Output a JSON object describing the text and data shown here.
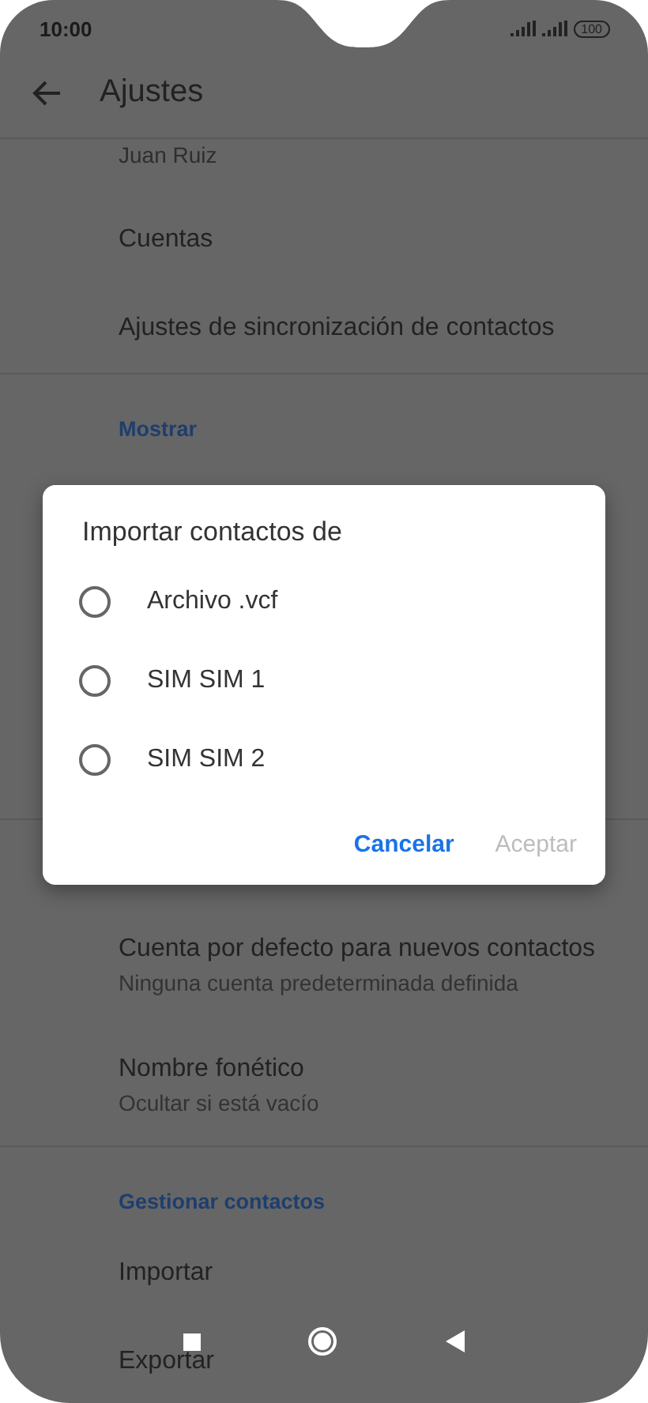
{
  "status_bar": {
    "time": "10:00",
    "battery": "100"
  },
  "toolbar": {
    "title": "Ajustes"
  },
  "top_items": [
    {
      "kind": "account",
      "title": "Juan Ruiz"
    },
    {
      "kind": "item",
      "title": "Cuentas"
    },
    {
      "kind": "item",
      "title": "Ajustes de sincronización de contactos"
    },
    {
      "kind": "section",
      "title": "Mostrar"
    }
  ],
  "bottom_items": [
    {
      "kind": "item",
      "title": "Cuenta por defecto para nuevos contactos",
      "subtitle": "Ninguna cuenta predeterminada definida"
    },
    {
      "kind": "item",
      "title": "Nombre fonético",
      "subtitle": "Ocultar si está vacío"
    },
    {
      "kind": "section",
      "title": "Gestionar contactos"
    },
    {
      "kind": "item",
      "title": "Importar"
    },
    {
      "kind": "item",
      "title": "Exportar"
    }
  ],
  "dialog": {
    "title": "Importar contactos de",
    "options": [
      {
        "label": "Archivo .vcf",
        "selected": false
      },
      {
        "label": "SIM SIM 1",
        "selected": false
      },
      {
        "label": "SIM SIM 2",
        "selected": false
      }
    ],
    "buttons": [
      {
        "label": "Cancelar",
        "disabled": false
      },
      {
        "label": "Aceptar",
        "disabled": true
      }
    ]
  }
}
